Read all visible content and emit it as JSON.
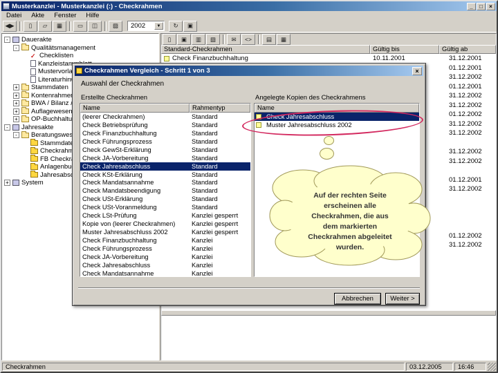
{
  "window": {
    "title": "Musterkanzlei - Musterkanzlei (:) - Checkrahmen",
    "minimize": "_",
    "maximize": "□",
    "close": "×"
  },
  "menu": {
    "items": [
      "Datei",
      "Akte",
      "Fenster",
      "Hilfe"
    ]
  },
  "toolbar": {
    "left_icons": [
      "nav-back-forward",
      "|",
      "new-document",
      "open-document",
      "table-view",
      "|",
      "print",
      "print-preview",
      "|",
      "chart-view"
    ],
    "year_value": "2002",
    "right_icons": [
      "refresh",
      "window-view"
    ]
  },
  "panel_toolbar": {
    "icons": [
      "new-document",
      "save",
      "copy",
      "paste",
      "|",
      "mail",
      "code-view",
      "|",
      "list-view",
      "columns-view"
    ]
  },
  "tree": {
    "items": [
      {
        "label": "Dauerakte",
        "level": 0,
        "icon": "book",
        "exp": "-"
      },
      {
        "label": "Qualitätsmanagement",
        "level": 1,
        "icon": "folder",
        "exp": "-"
      },
      {
        "label": "Checklisten",
        "level": 2,
        "icon": "check",
        "exp": ""
      },
      {
        "label": "Kanzleistammblatt",
        "level": 2,
        "icon": "doc",
        "exp": ""
      },
      {
        "label": "Mustervorlagen",
        "level": 2,
        "icon": "doc",
        "exp": ""
      },
      {
        "label": "Literaturhinweise",
        "level": 2,
        "icon": "doc",
        "exp": ""
      },
      {
        "label": "Stammdaten",
        "level": 1,
        "icon": "folder",
        "exp": "+"
      },
      {
        "label": "Kontenrahmen",
        "level": 1,
        "icon": "folder",
        "exp": "+"
      },
      {
        "label": "BWA / Bilanz / E...",
        "level": 1,
        "icon": "folder",
        "exp": "+"
      },
      {
        "label": "Auflagewesen",
        "level": 1,
        "icon": "folder",
        "exp": "+"
      },
      {
        "label": "OP-Buchhaltung",
        "level": 1,
        "icon": "folder",
        "exp": "+"
      },
      {
        "label": "Jahresakte",
        "level": 0,
        "icon": "book",
        "exp": "-"
      },
      {
        "label": "Beratungswese...",
        "level": 1,
        "icon": "folder",
        "exp": "-"
      },
      {
        "label": "Stammdaten (...",
        "level": 2,
        "icon": "folder-yellow",
        "exp": ""
      },
      {
        "label": "Checkrahmen",
        "level": 2,
        "icon": "folder-yellow",
        "exp": ""
      },
      {
        "label": "FB Checkrahmen",
        "level": 2,
        "icon": "folder-yellow",
        "exp": ""
      },
      {
        "label": "Anlagenbuchh...",
        "level": 2,
        "icon": "folder-yellow",
        "exp": ""
      },
      {
        "label": "Jahresabschl...",
        "level": 2,
        "icon": "folder-yellow",
        "exp": ""
      },
      {
        "label": "System",
        "level": 0,
        "icon": "book",
        "exp": "+"
      }
    ]
  },
  "main_table": {
    "columns": [
      "Standard-Checkrahmen",
      "Gültig bis",
      "Gültig ab"
    ],
    "rows": [
      {
        "name": "Check Finanzbuchhaltung",
        "bis": "10.11.2001",
        "ab": "31.12.2001"
      },
      {
        "name": "",
        "bis": "",
        "ab": "01.12.2001"
      },
      {
        "name": "",
        "bis": "",
        "ab": "31.12.2002"
      },
      {
        "name": "",
        "bis": "",
        "ab": "01.12.2001"
      },
      {
        "name": "",
        "bis": "",
        "ab": "31.12.2002"
      },
      {
        "name": "",
        "bis": "",
        "ab": "31.12.2002"
      },
      {
        "name": "",
        "bis": "",
        "ab": "01.12.2002"
      },
      {
        "name": "",
        "bis": "",
        "ab": "31.12.2002"
      },
      {
        "name": "",
        "bis": "",
        "ab": "31.12.2002"
      },
      {
        "name": "",
        "bis": "",
        "ab": ""
      },
      {
        "name": "",
        "bis": "",
        "ab": "31.12.2002"
      },
      {
        "name": "",
        "bis": "",
        "ab": "31.12.2002"
      },
      {
        "name": "",
        "bis": "",
        "ab": ""
      },
      {
        "name": "",
        "bis": "",
        "ab": "01.12.2001"
      },
      {
        "name": "",
        "bis": "",
        "ab": "31.12.2002"
      },
      {
        "name": "",
        "bis": "",
        "ab": ""
      },
      {
        "name": "",
        "bis": "",
        "ab": ""
      },
      {
        "name": "",
        "bis": "",
        "ab": ""
      },
      {
        "name": "",
        "bis": "",
        "ab": ""
      },
      {
        "name": "",
        "bis": "",
        "ab": "01.12.2002"
      },
      {
        "name": "",
        "bis": "",
        "ab": "31.12.2002"
      }
    ]
  },
  "dialog": {
    "title": "Checkrahmen Vergleich - Schritt 1 von 3",
    "heading": "Auswahl der Checkrahmen",
    "left_label": "Erstellte Checkrahmen",
    "right_label": "Angelegte Kopien des Checkrahmens",
    "left_table": {
      "columns": [
        "Name",
        "Rahmentyp"
      ],
      "rows": [
        {
          "name": "(leerer Checkrahmen)",
          "type": "Standard",
          "selected": false
        },
        {
          "name": "Check Betriebsprüfung",
          "type": "Standard",
          "selected": false
        },
        {
          "name": "Check Finanzbuchhaltung",
          "type": "Standard",
          "selected": false
        },
        {
          "name": "Check Führungsprozess",
          "type": "Standard",
          "selected": false
        },
        {
          "name": "Check GewSt-Erklärung",
          "type": "Standard",
          "selected": false
        },
        {
          "name": "Check JA-Vorbereitung",
          "type": "Standard",
          "selected": false
        },
        {
          "name": "Check Jahresabschluss",
          "type": "Standard",
          "selected": true
        },
        {
          "name": "Check KSt-Erklärung",
          "type": "Standard",
          "selected": false
        },
        {
          "name": "Check Mandatsannahme",
          "type": "Standard",
          "selected": false
        },
        {
          "name": "Check Mandatsbeendigung",
          "type": "Standard",
          "selected": false
        },
        {
          "name": "Check USt-Erklärung",
          "type": "Standard",
          "selected": false
        },
        {
          "name": "Check USt-Voranmeldung",
          "type": "Standard",
          "selected": false
        },
        {
          "name": "Check LSt-Prüfung",
          "type": "Kanzlei gesperrt",
          "selected": false
        },
        {
          "name": "Kopie von (leerer Checkrahmen)",
          "type": "Kanzlei gesperrt",
          "selected": false
        },
        {
          "name": "Muster Jahresabschluss 2002",
          "type": "Kanzlei gesperrt",
          "selected": false
        },
        {
          "name": "Check Finanzbuchhaltung",
          "type": "Kanzlei",
          "selected": false
        },
        {
          "name": "Check Führungsprozess",
          "type": "Kanzlei",
          "selected": false
        },
        {
          "name": "Check JA-Vorbereitung",
          "type": "Kanzlei",
          "selected": false
        },
        {
          "name": "Check Jahresabschluss",
          "type": "Kanzlei",
          "selected": false
        },
        {
          "name": "Check Mandatsannahme",
          "type": "Kanzlei",
          "selected": false
        }
      ]
    },
    "right_table": {
      "columns": [
        "Name"
      ],
      "rows": [
        {
          "name": "Check Jahresabschluss",
          "selected": true
        },
        {
          "name": "Muster Jahresabschluss 2002",
          "selected": false
        }
      ]
    },
    "buttons": {
      "cancel": "Abbrechen",
      "next": "Weiter >"
    }
  },
  "annotation": {
    "lines": [
      "Auf der rechten Seite",
      "erscheinen alle",
      "Checkrahmen, die aus",
      "dem markierten",
      "Checkrahmen abgeleitet",
      "wurden."
    ],
    "highlight_color": "#d3295f"
  },
  "statusbar": {
    "context": "Checkrahmen",
    "date": "03.12.2005",
    "time": "16:46"
  },
  "colors": {
    "titlebar_start": "#0a246a",
    "titlebar_end": "#a6caf0",
    "selection": "#0a246a",
    "chrome": "#d4d0c8",
    "bubble_fill": "#ffffcc"
  }
}
